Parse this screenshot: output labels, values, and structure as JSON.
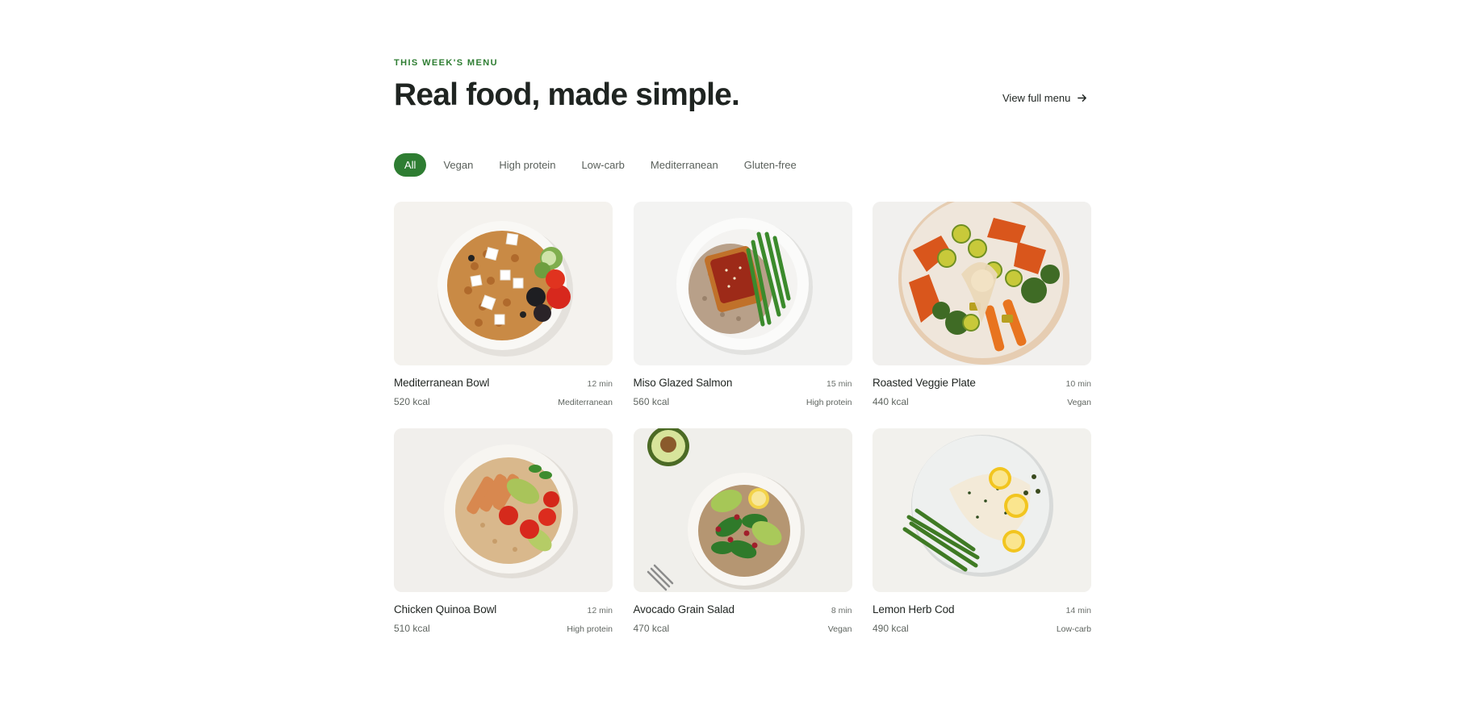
{
  "header": {
    "eyebrow": "THIS WEEK'S MENU",
    "headline": "Real food, made simple.",
    "view_link": "View full menu"
  },
  "filters": [
    {
      "label": "All",
      "active": true
    },
    {
      "label": "Vegan",
      "active": false
    },
    {
      "label": "High protein",
      "active": false
    },
    {
      "label": "Low-carb",
      "active": false
    },
    {
      "label": "Mediterranean",
      "active": false
    },
    {
      "label": "Gluten-free",
      "active": false
    }
  ],
  "meals": [
    {
      "title": "Mediterranean Bowl",
      "time": "12 min",
      "kcal": "520 kcal",
      "tag": "Mediterranean"
    },
    {
      "title": "Miso Glazed Salmon",
      "time": "15 min",
      "kcal": "560 kcal",
      "tag": "High protein"
    },
    {
      "title": "Roasted Veggie Plate",
      "time": "10 min",
      "kcal": "440 kcal",
      "tag": "Vegan"
    },
    {
      "title": "Chicken Quinoa Bowl",
      "time": "12 min",
      "kcal": "510 kcal",
      "tag": "High protein"
    },
    {
      "title": "Avocado Grain Salad",
      "time": "8 min",
      "kcal": "470 kcal",
      "tag": "Vegan"
    },
    {
      "title": "Lemon Herb Cod",
      "time": "14 min",
      "kcal": "490 kcal",
      "tag": "Low-carb"
    }
  ],
  "colors": {
    "accent": "#2e7d32",
    "text": "#1f2421",
    "muted": "#5f6560"
  },
  "icons": {
    "view_link": "arrow-right-icon"
  }
}
